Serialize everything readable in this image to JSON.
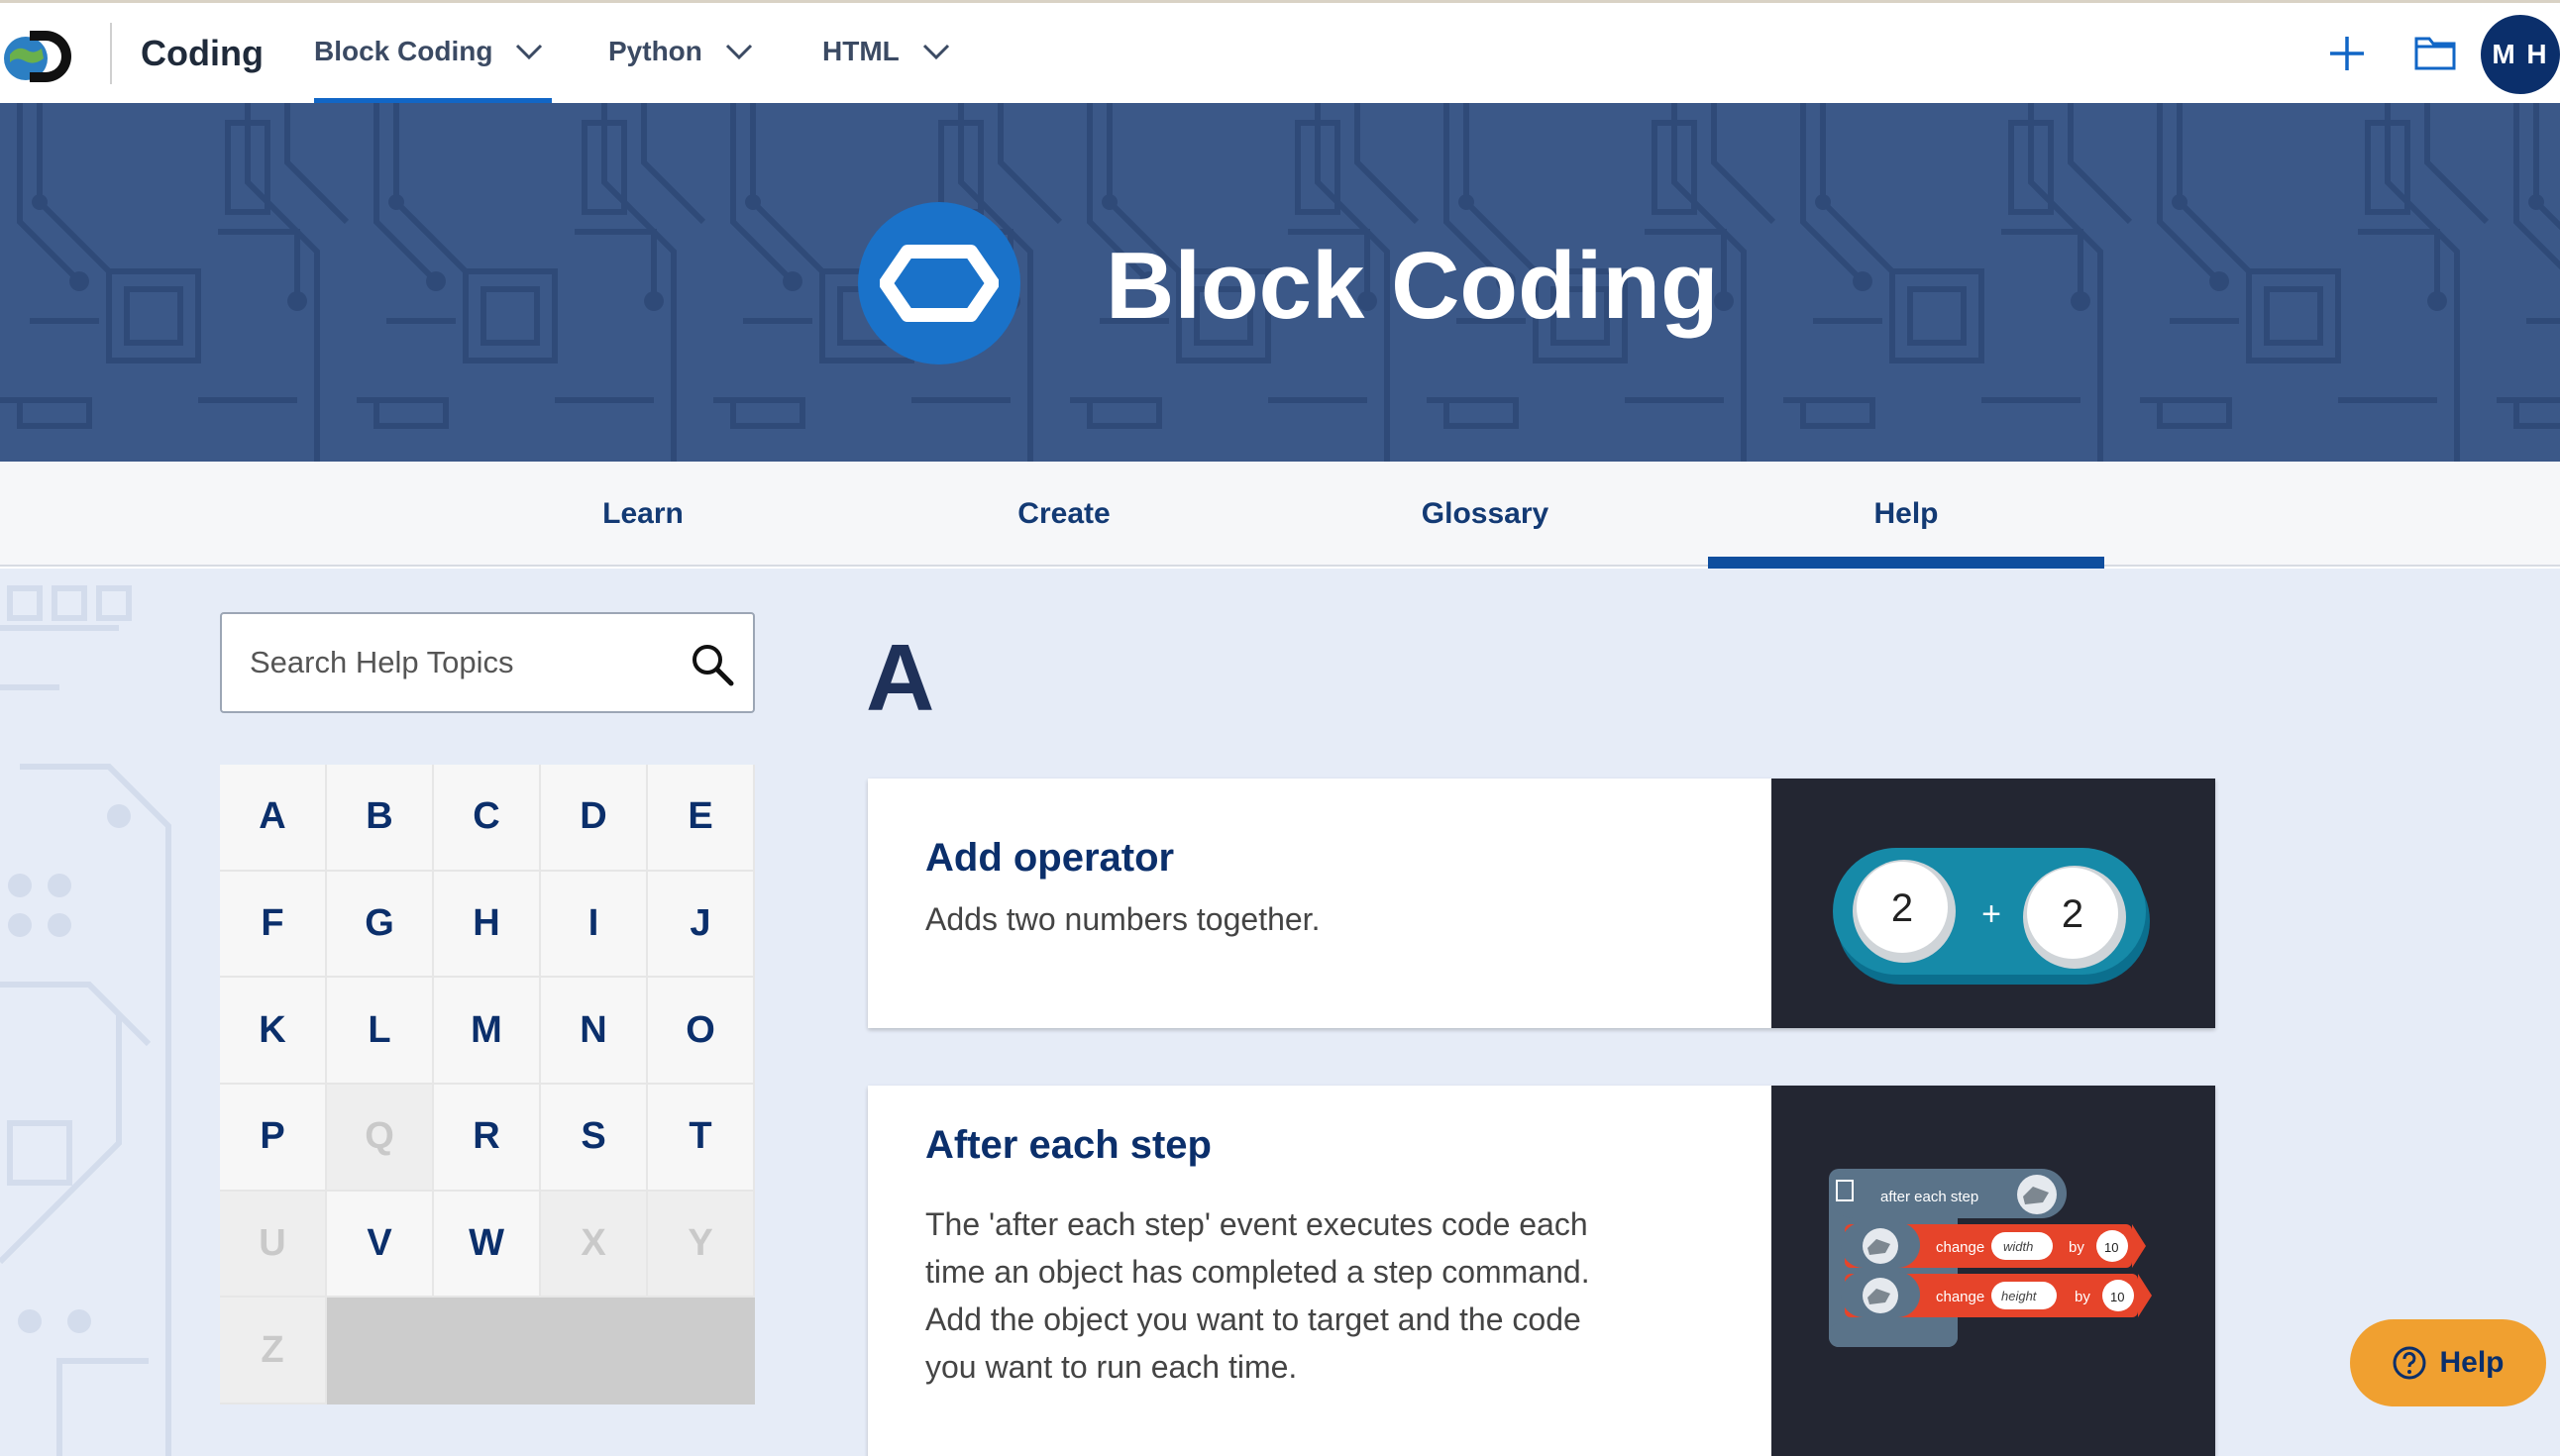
{
  "topnav": {
    "brand": "Coding",
    "items": [
      {
        "label": "Block Coding"
      },
      {
        "label": "Python"
      },
      {
        "label": "HTML"
      }
    ],
    "avatar_initials": "M H"
  },
  "banner": {
    "title": "Block Coding"
  },
  "subtabs": [
    {
      "label": "Learn"
    },
    {
      "label": "Create"
    },
    {
      "label": "Glossary"
    },
    {
      "label": "Help"
    }
  ],
  "search": {
    "placeholder": "Search Help Topics"
  },
  "alphabet": [
    {
      "letter": "A",
      "enabled": true
    },
    {
      "letter": "B",
      "enabled": true
    },
    {
      "letter": "C",
      "enabled": true
    },
    {
      "letter": "D",
      "enabled": true
    },
    {
      "letter": "E",
      "enabled": true
    },
    {
      "letter": "F",
      "enabled": true
    },
    {
      "letter": "G",
      "enabled": true
    },
    {
      "letter": "H",
      "enabled": true
    },
    {
      "letter": "I",
      "enabled": true
    },
    {
      "letter": "J",
      "enabled": true
    },
    {
      "letter": "K",
      "enabled": true
    },
    {
      "letter": "L",
      "enabled": true
    },
    {
      "letter": "M",
      "enabled": true
    },
    {
      "letter": "N",
      "enabled": true
    },
    {
      "letter": "O",
      "enabled": true
    },
    {
      "letter": "P",
      "enabled": true
    },
    {
      "letter": "Q",
      "enabled": false
    },
    {
      "letter": "R",
      "enabled": true
    },
    {
      "letter": "S",
      "enabled": true
    },
    {
      "letter": "T",
      "enabled": true
    },
    {
      "letter": "U",
      "enabled": false
    },
    {
      "letter": "V",
      "enabled": true
    },
    {
      "letter": "W",
      "enabled": true
    },
    {
      "letter": "X",
      "enabled": false
    },
    {
      "letter": "Y",
      "enabled": false
    },
    {
      "letter": "Z",
      "enabled": false
    }
  ],
  "section_letter": "A",
  "cards": [
    {
      "title": "Add operator",
      "description": "Adds two numbers together.",
      "image": {
        "left_value": "2",
        "operator": "+",
        "right_value": "2"
      }
    },
    {
      "title": "After each step",
      "description_lines": [
        "The 'after each step' event executes code each",
        "time an object has completed a step command.",
        "Add the object you want to target and the code",
        "you want to run each time."
      ],
      "image": {
        "event_label": "after each step",
        "rows": [
          {
            "action": "change",
            "property": "width",
            "by": "by",
            "value": "10"
          },
          {
            "action": "change",
            "property": "height",
            "by": "by",
            "value": "10"
          }
        ]
      }
    }
  ],
  "help_fab": {
    "label": "Help"
  }
}
